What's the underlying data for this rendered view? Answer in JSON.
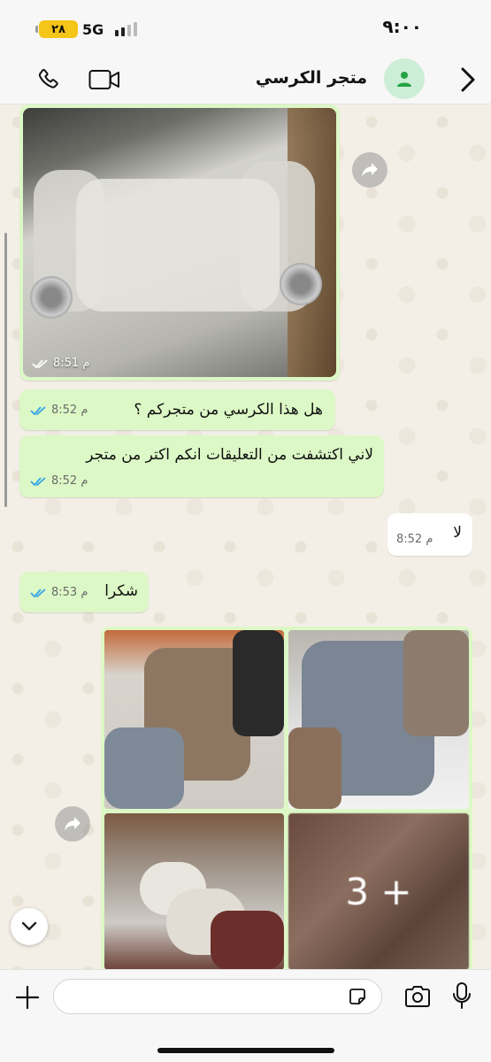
{
  "status_bar": {
    "time": "٩:٠٠",
    "battery": "٢٨",
    "network": "5G"
  },
  "header": {
    "contact_name": "متجر الكرسي",
    "icons": [
      "back-chevron-icon",
      "avatar-person-icon",
      "video-call-icon",
      "phone-call-icon"
    ]
  },
  "messages": [
    {
      "type": "image",
      "direction": "outgoing",
      "time": "8:51 م",
      "status": "read"
    },
    {
      "type": "text",
      "direction": "outgoing",
      "text": "هل هذا الكرسي من متجركم ؟",
      "time": "8:52 م",
      "status": "read"
    },
    {
      "type": "text",
      "direction": "outgoing",
      "text": "لاني اكتشفت من التعليقات انكم اكتر من متجر",
      "time": "8:52 م",
      "status": "read"
    },
    {
      "type": "text",
      "direction": "incoming",
      "text": "لا",
      "time": "8:52 م"
    },
    {
      "type": "text",
      "direction": "outgoing",
      "text": "شكرا",
      "time": "8:53 م",
      "status": "read"
    },
    {
      "type": "image_grid",
      "direction": "incoming",
      "more_label": "3 +"
    }
  ],
  "input": {
    "placeholder": ""
  },
  "colors": {
    "outgoing_bubble": "#dcf8c6",
    "incoming_bubble": "#ffffff",
    "read_ticks": "#34a5e6",
    "avatar_bg": "#cdeed6",
    "avatar_fg": "#25a244"
  }
}
